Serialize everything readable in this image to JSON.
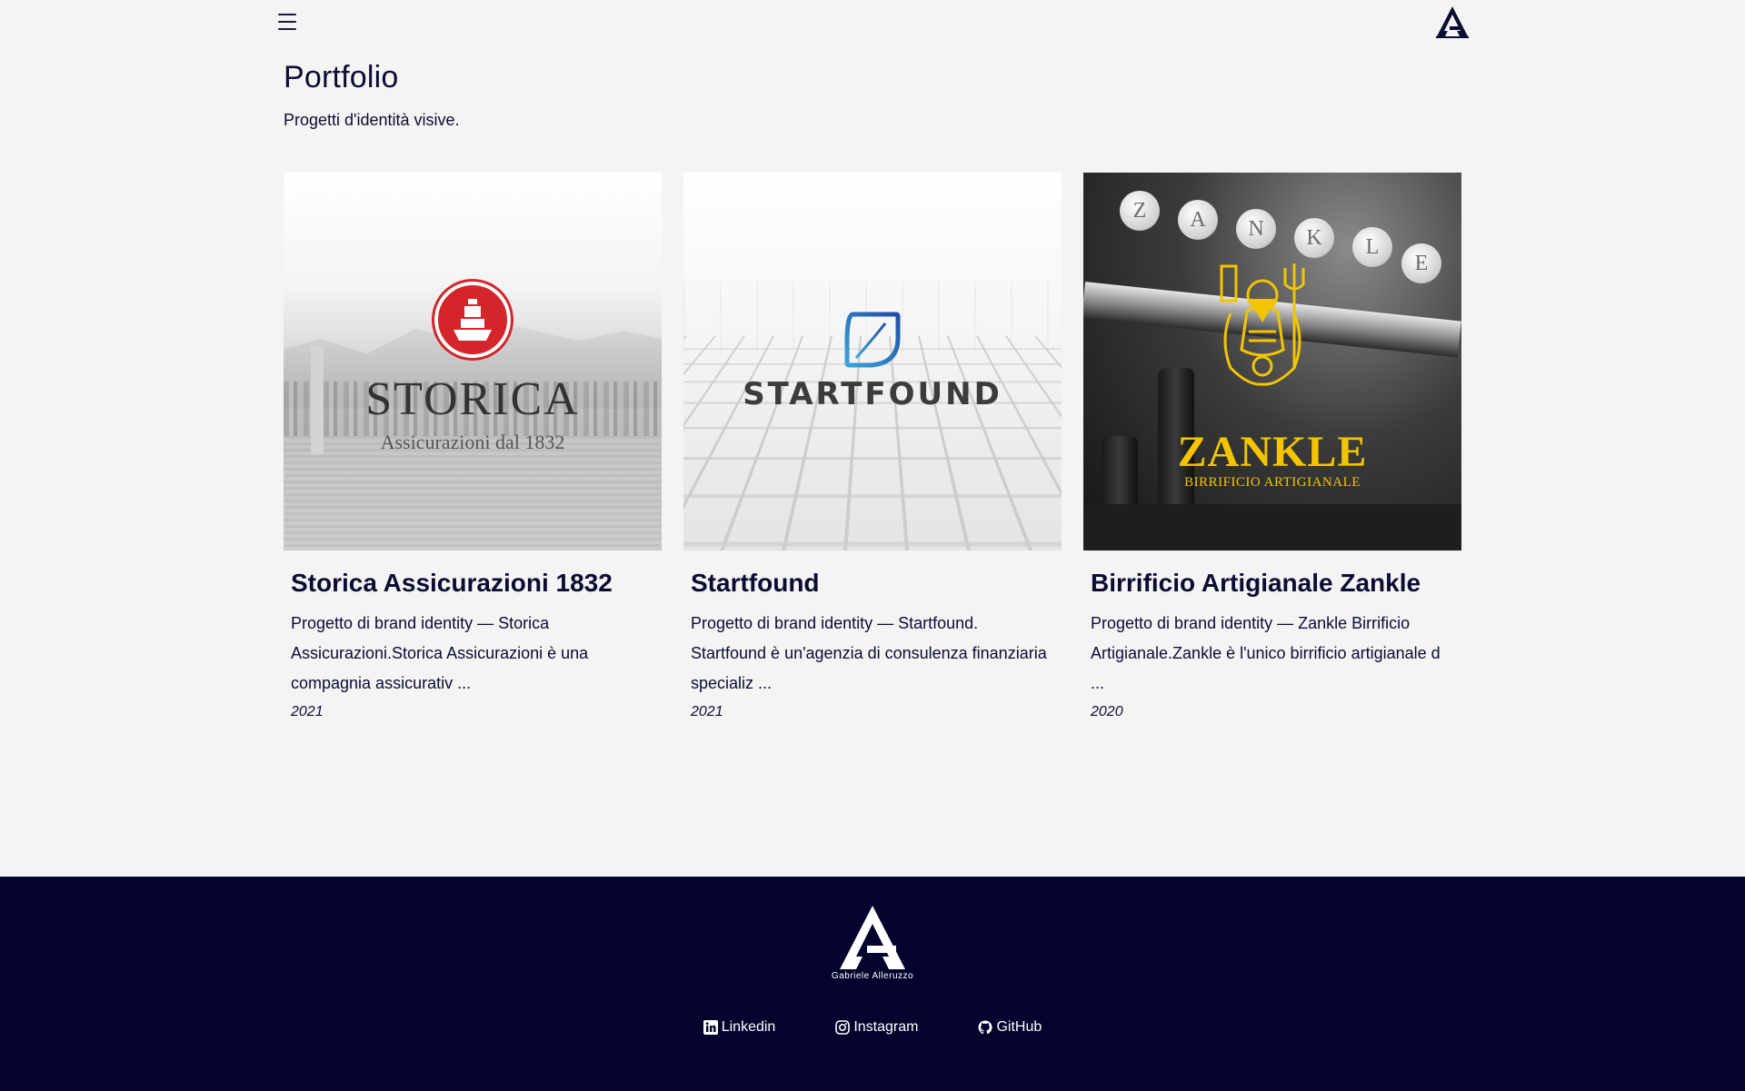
{
  "header": {
    "menu_icon": "hamburger-menu-icon",
    "logo_icon": "ag-logo-icon"
  },
  "page": {
    "title": "Portfolio",
    "subtitle": "Progetti d'identità visive."
  },
  "projects": [
    {
      "title": "Storica Assicurazioni 1832",
      "description": "Progetto di brand identity — Storica Assicurazioni.Storica Assicurazioni è una compagnia assicurativ ...",
      "year": "2021",
      "image_wordmark": "STORICA",
      "image_tagline": "Assicurazioni dal 1832",
      "accent": "#d4252a"
    },
    {
      "title": "Startfound",
      "description": "Progetto di brand identity — Startfound. Startfound è un'agenzia di consulenza finanziaria specializ ...",
      "year": "2021",
      "image_wordmark": "STARTFOUND",
      "accent": "#2f7fc7"
    },
    {
      "title": "Birrificio Artigianale Zankle",
      "description": "Progetto di brand identity — Zankle Birrificio Artigianale.Zankle è l'unico birrificio artigianale d ...",
      "year": "2020",
      "image_wordmark": "ZANKLE",
      "image_tagline": "BIRRIFICIO ARTIGIANALE",
      "tap_letters": [
        "Z",
        "A",
        "N",
        "K",
        "L",
        "E"
      ],
      "accent": "#f2c500"
    }
  ],
  "footer": {
    "brand": "Gabriele Alleruzzo",
    "background": "#03032e",
    "links": [
      {
        "label": "Linkedin",
        "icon": "linkedin-icon"
      },
      {
        "label": "Instagram",
        "icon": "instagram-icon"
      },
      {
        "label": "GitHub",
        "icon": "github-icon"
      }
    ]
  },
  "colors": {
    "background": "#f4f4f4",
    "text": "#0c0c33"
  }
}
